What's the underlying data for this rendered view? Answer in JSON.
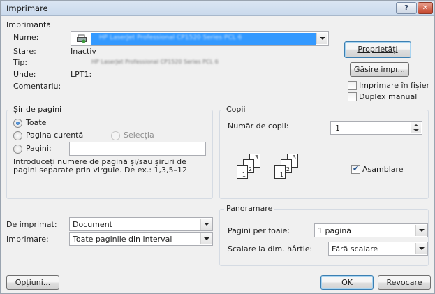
{
  "window": {
    "title": "Imprimare",
    "help": "?",
    "close": "✕"
  },
  "printer": {
    "group_title": "Imprimantă",
    "name_label": "Nume:",
    "name_value": "HP LaserJet Professional CP1520 Series PCL 6",
    "status_label": "Stare:",
    "status_value": "Inactiv",
    "type_label": "Tip:",
    "type_value": "HP LaserJet Professional CP1520 Series PCL 6",
    "where_label": "Unde:",
    "where_value": "LPT1:",
    "comment_label": "Comentariu:",
    "properties_button": "Proprietăți",
    "find_button": "Găsire impr...",
    "print_to_file": "Imprimare în fișier",
    "manual_duplex": "Duplex manual"
  },
  "page_range": {
    "group_title": "Șir de pagini",
    "all": "Toate",
    "current": "Pagina curentă",
    "selection": "Selecția",
    "pages": "Pagini:",
    "hint": "Introduceți numere de pagină și/sau șiruri de pagini separate prin virgule. De ex.: 1,3,5–12"
  },
  "copies": {
    "group_title": "Copii",
    "count_label": "Număr de copii:",
    "count_value": "1",
    "collate": "Asamblare",
    "page_nums": [
      "3",
      "2",
      "1",
      "3",
      "2",
      "1"
    ]
  },
  "print_what": {
    "label": "De imprimat:",
    "value": "Document"
  },
  "print_range": {
    "label": "Imprimare:",
    "value": "Toate paginile din interval"
  },
  "zoom": {
    "group_title": "Panoramare",
    "per_sheet_label": "Pagini per foaie:",
    "per_sheet_value": "1 pagină",
    "scale_label": "Scalare la dim. hârtie:",
    "scale_value": "Fără scalare"
  },
  "footer": {
    "options": "Opțiuni...",
    "ok": "OK",
    "cancel": "Revocare"
  }
}
